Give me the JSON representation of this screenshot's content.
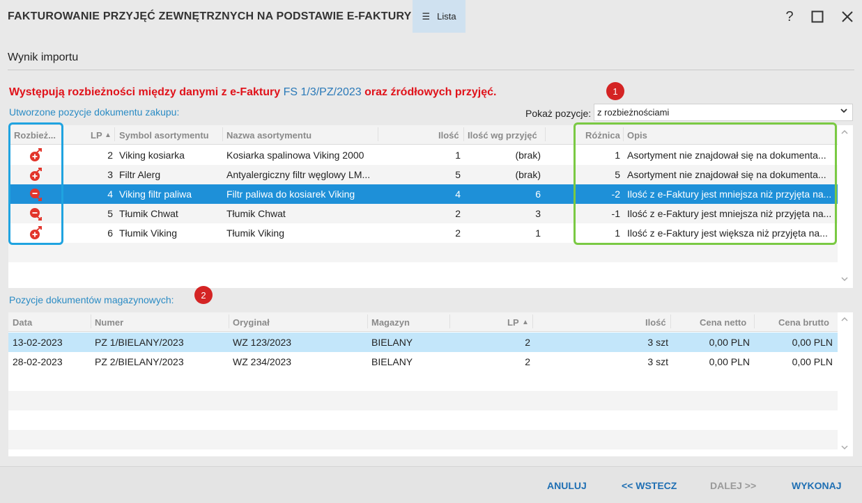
{
  "window": {
    "title": "FAKTUROWANIE PRZYJĘĆ ZEWNĘTRZNYCH NA PODSTAWIE E-FAKTURY",
    "list_tab": "Lista",
    "help": "?",
    "maximize": "☐",
    "close": "✕"
  },
  "section_title": "Wynik importu",
  "warning": {
    "part1": "Występują rozbieżności między danymi z e-Faktury ",
    "doc_ref": "FS 1/3/PZ/2023",
    "part2": " oraz źródłowych przyjęć."
  },
  "badges": {
    "one": "1",
    "two": "2"
  },
  "purchase": {
    "label": "Utworzone pozycje dokumentu zakupu:",
    "show_label": "Pokaż pozycje:",
    "show_value": "z rozbieżnościami",
    "columns": [
      "Rozbież...",
      "LP",
      "Symbol asortymentu",
      "Nazwa asortymentu",
      "Ilość",
      "Ilość wg przyjęć",
      "Różnica",
      "Opis"
    ],
    "rows": [
      {
        "icon": "plus",
        "lp": "2",
        "symbol": "Viking kosiarka",
        "name": "Kosiarka spalinowa Viking 2000",
        "qty": "1",
        "qty_receipts": "(brak)",
        "diff": "1",
        "desc": "Asortyment nie znajdował się na dokumenta..."
      },
      {
        "icon": "plus",
        "lp": "3",
        "symbol": "Filtr Alerg",
        "name": "Antyalergiczny filtr węglowy LM...",
        "qty": "5",
        "qty_receipts": "(brak)",
        "diff": "5",
        "desc": "Asortyment nie znajdował się na dokumenta..."
      },
      {
        "icon": "minus",
        "lp": "4",
        "symbol": "Viking filtr paliwa",
        "name": "Filtr paliwa do kosiarek Viking",
        "qty": "4",
        "qty_receipts": "6",
        "diff": "-2",
        "desc": "Ilość z e-Faktury jest mniejsza niż przyjęta na..."
      },
      {
        "icon": "minus",
        "lp": "5",
        "symbol": "Tłumik Chwat",
        "name": "Tłumik Chwat",
        "qty": "2",
        "qty_receipts": "3",
        "diff": "-1",
        "desc": "Ilość z e-Faktury jest mniejsza niż przyjęta na..."
      },
      {
        "icon": "plus",
        "lp": "6",
        "symbol": "Tłumik Viking",
        "name": "Tłumik Viking",
        "qty": "2",
        "qty_receipts": "1",
        "diff": "1",
        "desc": "Ilość z e-Faktury jest większa niż przyjęta na..."
      }
    ],
    "selected_row": 2
  },
  "warehouse": {
    "label": "Pozycje dokumentów magazynowych:",
    "columns": [
      "Data",
      "Numer",
      "Oryginał",
      "Magazyn",
      "LP",
      "Ilość",
      "Cena netto",
      "Cena brutto"
    ],
    "rows": [
      {
        "date": "13-02-2023",
        "number": "PZ 1/BIELANY/2023",
        "original": "WZ 123/2023",
        "warehouse": "BIELANY",
        "lp": "2",
        "qty": "3 szt",
        "net": "0,00 PLN",
        "gross": "0,00 PLN"
      },
      {
        "date": "28-02-2023",
        "number": "PZ 2/BIELANY/2023",
        "original": "WZ 234/2023",
        "warehouse": "BIELANY",
        "lp": "2",
        "qty": "3 szt",
        "net": "0,00 PLN",
        "gross": "0,00 PLN"
      }
    ],
    "selected_row": 0
  },
  "footer": {
    "cancel": "ANULUJ",
    "back": "<< WSTECZ",
    "next": "DALEJ >>",
    "execute": "WYKONAJ"
  },
  "colors": {
    "selected_row": "#1e90d8",
    "light_selected_row": "#c3e6fa",
    "warning_red": "#e0121a",
    "link_blue": "#2a79b8",
    "button_blue": "#1f6fb3",
    "disabled_gray": "#9a9a9a",
    "icon_red": "#e2352b",
    "blue_outline": "#1fa3e0",
    "green_outline": "#7ac943"
  },
  "icons": {
    "menu": "menu-icon",
    "sort": "sort-ascending-icon",
    "dropdown": "chevron-down-icon",
    "scroll_up": "chevron-up-icon",
    "scroll_down": "chevron-down-icon",
    "diff_plus": "difference-plus-icon",
    "diff_minus": "difference-minus-icon"
  }
}
